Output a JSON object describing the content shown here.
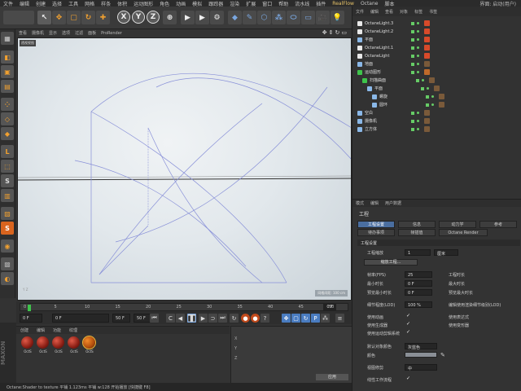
{
  "menubar": {
    "items": [
      "文件",
      "编辑",
      "创建",
      "选择",
      "工具",
      "网格",
      "样条",
      "体积",
      "运动图形",
      "角色",
      "动画",
      "模拟",
      "跟踪器",
      "渲染",
      "扩展",
      "窗口",
      "帮助",
      "流水线",
      "插件",
      "RealFlow",
      "Octane",
      "脚本"
    ],
    "realflow": "RealFlow",
    "interface": "界面: 启动(用户)"
  },
  "viewport": {
    "menu": [
      "查看",
      "摄像机",
      "显示",
      "选项",
      "过滤",
      "面板",
      "ProRender"
    ],
    "label": "透视视图",
    "badge": "网格间距: 100 cm",
    "axes": "Y Z"
  },
  "timeline": {
    "ticks": [
      "0",
      "5",
      "10",
      "15",
      "20",
      "25",
      "30",
      "35",
      "40",
      "45",
      "50"
    ],
    "end_frame": "0 F",
    "field_start": "0 F",
    "field_current": "0 F",
    "field_end": "50 F",
    "field_end2": "50 F",
    "progress": 0.0
  },
  "materials": {
    "tabs": [
      "创建",
      "编辑",
      "功能",
      "纹理"
    ],
    "items": [
      {
        "label": "OctS",
        "kind": "red"
      },
      {
        "label": "OctS",
        "kind": "red"
      },
      {
        "label": "OctS",
        "kind": "red"
      },
      {
        "label": "OctS",
        "kind": "red"
      },
      {
        "label": "OctS",
        "kind": "gold"
      }
    ]
  },
  "coords": {
    "rows": [
      "X",
      "Y",
      "Z"
    ],
    "apply": "应用"
  },
  "status": "Octane:Shader to texture 平铺 1.123ms  平铺 w:128  开始播放 [快捷键 F8]",
  "objects": {
    "menu": [
      "文件",
      "编辑",
      "查看",
      "对象",
      "标签",
      "书签"
    ],
    "rows": [
      {
        "name": "OctaneLight.3",
        "color": "#e8e8e8",
        "indent": 0
      },
      {
        "name": "OctaneLight.2",
        "color": "#e8e8e8",
        "indent": 0
      },
      {
        "name": "平面",
        "color": "#8ab8e8",
        "indent": 0
      },
      {
        "name": "OctaneLight.1",
        "color": "#e8e8e8",
        "indent": 0
      },
      {
        "name": "OctaneLight",
        "color": "#e8e8e8",
        "indent": 0
      },
      {
        "name": "地面",
        "color": "#8ab8e8",
        "indent": 0
      },
      {
        "name": "运动图形",
        "color": "#3ec44b",
        "indent": 0
      },
      {
        "name": "扫描曲面",
        "color": "#3ec44b",
        "indent": 1
      },
      {
        "name": "平面",
        "color": "#8ab8e8",
        "indent": 2
      },
      {
        "name": "螺旋",
        "color": "#8ab8e8",
        "indent": 3
      },
      {
        "name": "圆环",
        "color": "#8ab8e8",
        "indent": 3
      },
      {
        "name": "空白",
        "color": "#8ab8e8",
        "indent": 0
      },
      {
        "name": "摄像机",
        "color": "#8ab8e8",
        "indent": 0
      },
      {
        "name": "立方体",
        "color": "#8ab8e8",
        "indent": 0
      }
    ]
  },
  "attributes": {
    "menu": [
      "模式",
      "编辑",
      "用户数据"
    ],
    "title": "工程",
    "tabs": [
      "工程设置",
      "信息",
      "动力学",
      "参考",
      "待办事项",
      "帧插值",
      "Octane Render"
    ],
    "section": "工程设置",
    "scale_label": "工程缩放",
    "scale_value": "1",
    "scale_unit": "厘米",
    "scale_button": "缩放工程...",
    "fps_label": "帧率(FPS)",
    "fps_value": "25",
    "time_label": "工程时长",
    "mintime_label": "最小时长",
    "mintime_value": "0 F",
    "maxtime_label": "最大时长",
    "premin_label": "预览最小时长",
    "premin_value": "0 F",
    "premax_label": "预览最大时长",
    "lod_label": "细节程度(LOD)",
    "lod_value": "100 %",
    "lod_render": "编辑使用渲染细节级别(LOD)",
    "anim_label": "使用动画",
    "expr_label": "使用表达式",
    "gen_label": "使用生成器",
    "deform_label": "使用变形器",
    "motion_label": "使用运动剪辑系统",
    "objcolor_label": "默认对象颜色",
    "objcolor_value": "灰蓝色",
    "color_label": "颜色",
    "view_label": "视图修剪",
    "view_value": "中",
    "linear_label": "线性工作流程"
  }
}
